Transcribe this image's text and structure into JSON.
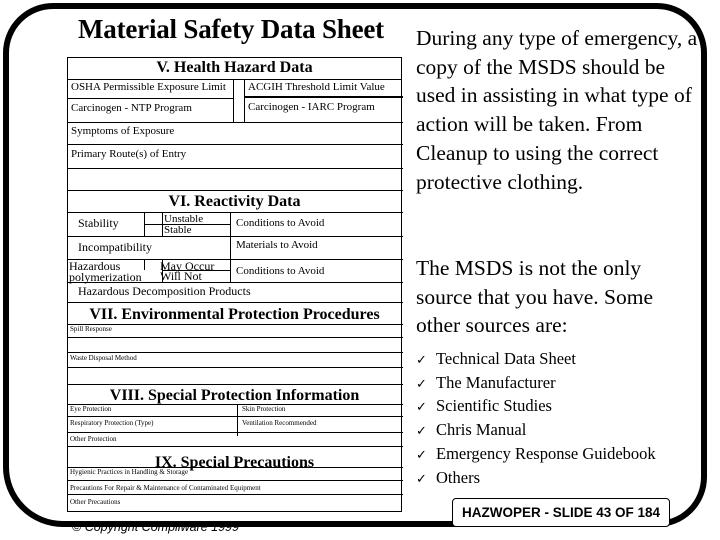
{
  "title": "Material Safety Data Sheet",
  "sheet": {
    "section5": {
      "heading": "V. Health Hazard Data",
      "osha": "OSHA Permissible Exposure Limit",
      "acgih": "ACGIH Threshold Limit Value",
      "ntp": "Carcinogen - NTP Program",
      "iarc": "Carcinogen - IARC Program",
      "symptoms": "Symptoms of Exposure",
      "routes": "Primary Route(s) of Entry"
    },
    "section6": {
      "heading": "VI. Reactivity Data",
      "stability": "Stability",
      "unstable": "Unstable",
      "stable": "Stable",
      "conditions1": "Conditions to Avoid",
      "incompatibility": "Incompatibility",
      "materials": "Materials to Avoid",
      "hazardous": "Hazardous",
      "polymerization": "polymerization",
      "may_occur": "May Occur",
      "will_not": "Will Not",
      "conditions2": "Conditions to Avoid",
      "decomposition": "Hazardous Decomposition Products"
    },
    "section7": {
      "heading": "VII. Environmental Protection Procedures",
      "spill": "Spill Response",
      "waste": "Waste Disposal Method"
    },
    "section8": {
      "heading": "VIII. Special Protection Information",
      "eye": "Eye Protection",
      "skin": "Skin Protection",
      "respiratory": "Respiratory Protection (Type)",
      "ventilation": "Ventilation Recommended",
      "other": "Other Protection"
    },
    "section9": {
      "heading": "IX. Special Precautions",
      "hygienic": "Hygienic Practices in Handling & Storage",
      "repair": "Precautions For Repair & Maintenance of Contaminated Equipment",
      "other": "Other Precautions"
    }
  },
  "body": {
    "paragraph1": "During any type of emergency, a copy of the MSDS should be used in assisting in what type of action will be taken.  From Cleanup to using the correct protective clothing.",
    "paragraph2": "The MSDS is not the only source that you have.  Some other sources are:",
    "check_glyph": "✓",
    "sources": [
      "Technical Data Sheet",
      "The Manufacturer",
      "Scientific Studies",
      "Chris Manual",
      "Emergency Response Guidebook",
      "Others"
    ]
  },
  "footer": {
    "copyright_symbol": "©",
    "copyright": "Copyright Compliware 1999",
    "slide_badge": "HAZWOPER - SLIDE 43 OF 184"
  }
}
